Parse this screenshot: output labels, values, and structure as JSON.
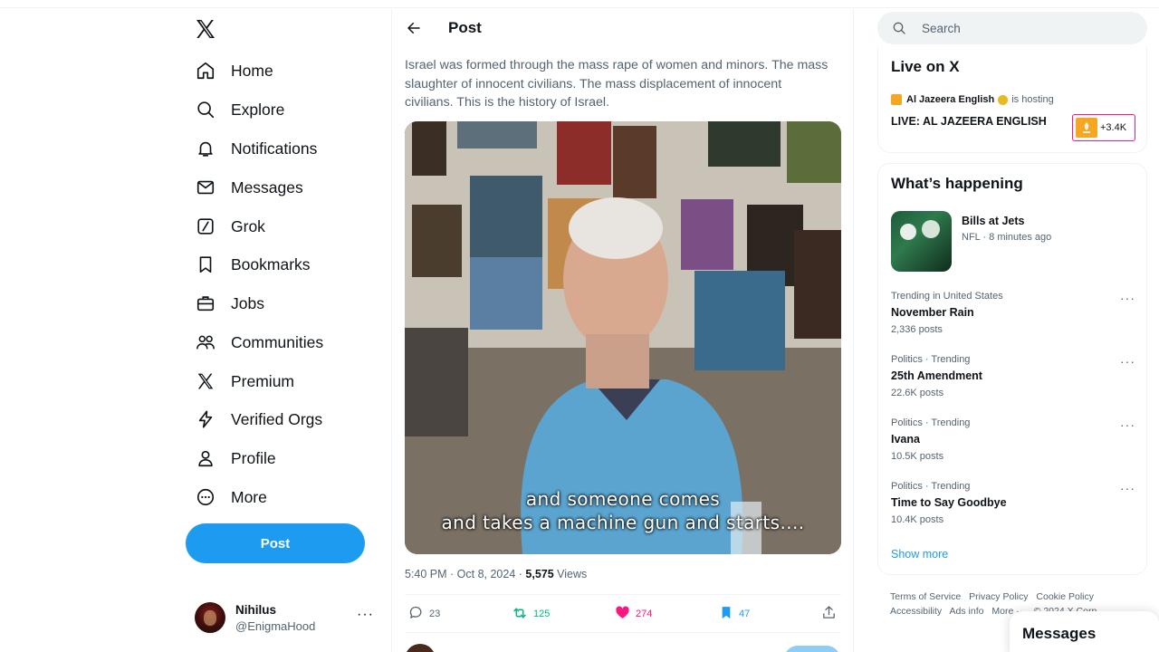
{
  "nav": {
    "items": [
      {
        "label": "Home",
        "icon": "home-icon"
      },
      {
        "label": "Explore",
        "icon": "search-icon"
      },
      {
        "label": "Notifications",
        "icon": "bell-icon"
      },
      {
        "label": "Messages",
        "icon": "envelope-icon"
      },
      {
        "label": "Grok",
        "icon": "grok-icon"
      },
      {
        "label": "Bookmarks",
        "icon": "bookmark-icon"
      },
      {
        "label": "Jobs",
        "icon": "briefcase-icon"
      },
      {
        "label": "Communities",
        "icon": "people-icon"
      },
      {
        "label": "Premium",
        "icon": "x-logo-icon"
      },
      {
        "label": "Verified Orgs",
        "icon": "lightning-icon"
      },
      {
        "label": "Profile",
        "icon": "person-icon"
      },
      {
        "label": "More",
        "icon": "more-circle-icon"
      }
    ],
    "post_button": "Post",
    "account": {
      "name": "Nihilus",
      "handle": "@EnigmaHood"
    }
  },
  "post": {
    "header_title": "Post",
    "text": "Israel was formed through the mass rape of women and minors.  The mass slaughter of innocent civilians.  The mass displacement of innocent civilians.  This is the history of Israel.",
    "video_caption_line1": "and someone comes",
    "video_caption_line2": "and takes a machine gun and starts....",
    "timestamp": "5:40 PM · Oct 8, 2024 · ",
    "views_count": "5,575",
    "views_label": " Views",
    "actions": {
      "replies": "23",
      "reposts": "125",
      "likes": "274",
      "bookmarks": "47"
    }
  },
  "right": {
    "search_placeholder": "Search",
    "live": {
      "heading": "Live on X",
      "host_name": "Al Jazeera English",
      "host_suffix": "is hosting",
      "title": "LIVE: AL JAZEERA ENGLISH",
      "listeners": "+3.4K"
    },
    "happening": {
      "heading": "What’s happening",
      "featured": {
        "title": "Bills at Jets",
        "subtitle": "NFL · 8 minutes ago"
      },
      "trends": [
        {
          "context": "Trending in United States",
          "name": "November Rain",
          "count": "2,336 posts"
        },
        {
          "context": "Politics · Trending",
          "name": "25th Amendment",
          "count": "22.6K posts"
        },
        {
          "context": "Politics · Trending",
          "name": "Ivana",
          "count": "10.5K posts"
        },
        {
          "context": "Politics · Trending",
          "name": "Time to Say Goodbye",
          "count": "10.4K posts"
        }
      ],
      "show_more": "Show more"
    },
    "footer": {
      "links": [
        "Terms of Service",
        "Privacy Policy",
        "Cookie Policy",
        "Accessibility",
        "Ads info",
        "More ···",
        "© 2024 X Corp."
      ]
    },
    "messages_drawer": "Messages"
  },
  "colors": {
    "accent": "#1d9bf0",
    "like": "#f91880",
    "repost": "#00ba7c",
    "muted": "#536471"
  }
}
